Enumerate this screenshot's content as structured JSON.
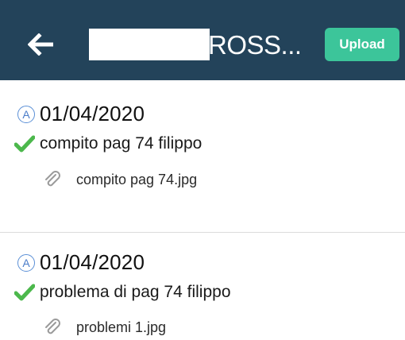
{
  "header": {
    "back_icon": "arrow-left-icon",
    "title": "ROSS...",
    "upload_label": "Upload",
    "background": "#23435a",
    "upload_color": "#3cc59a"
  },
  "entries": [
    {
      "badge": "A",
      "date": "01/04/2020",
      "task": "compito pag 74 filippo",
      "task_icon": "checkmark-icon",
      "attachment": "compito pag 74.jpg",
      "attachment_icon": "paperclip-icon"
    },
    {
      "badge": "A",
      "date": "01/04/2020",
      "task": "problema di pag 74 filippo",
      "task_icon": "checkmark-icon",
      "attachment": "problemi 1.jpg",
      "attachment_icon": "paperclip-icon"
    }
  ]
}
